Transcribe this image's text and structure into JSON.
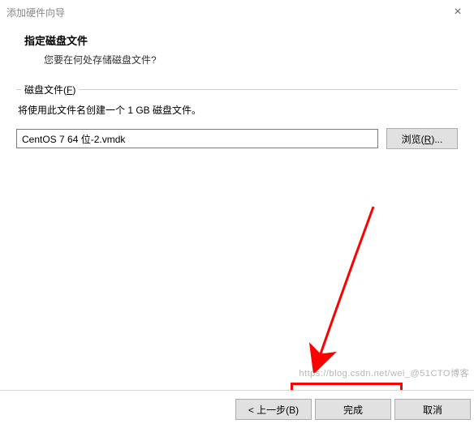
{
  "titlebar": {
    "title": "添加硬件向导",
    "close_glyph": "×"
  },
  "header": {
    "heading": "指定磁盘文件",
    "subheading": "您要在何处存储磁盘文件?"
  },
  "fieldset": {
    "legend_text": "磁盘文件(",
    "legend_key": "F",
    "legend_close": ")",
    "description": "将使用此文件名创建一个 1 GB 磁盘文件。",
    "file_value": "CentOS 7 64 位-2.vmdk",
    "browse_label": "浏览(R)..."
  },
  "buttons": {
    "back": "< 上一步(B)",
    "finish": "完成",
    "cancel": "取消"
  },
  "watermark": "https://blog.csdn.net/wei_@51CTO博客"
}
